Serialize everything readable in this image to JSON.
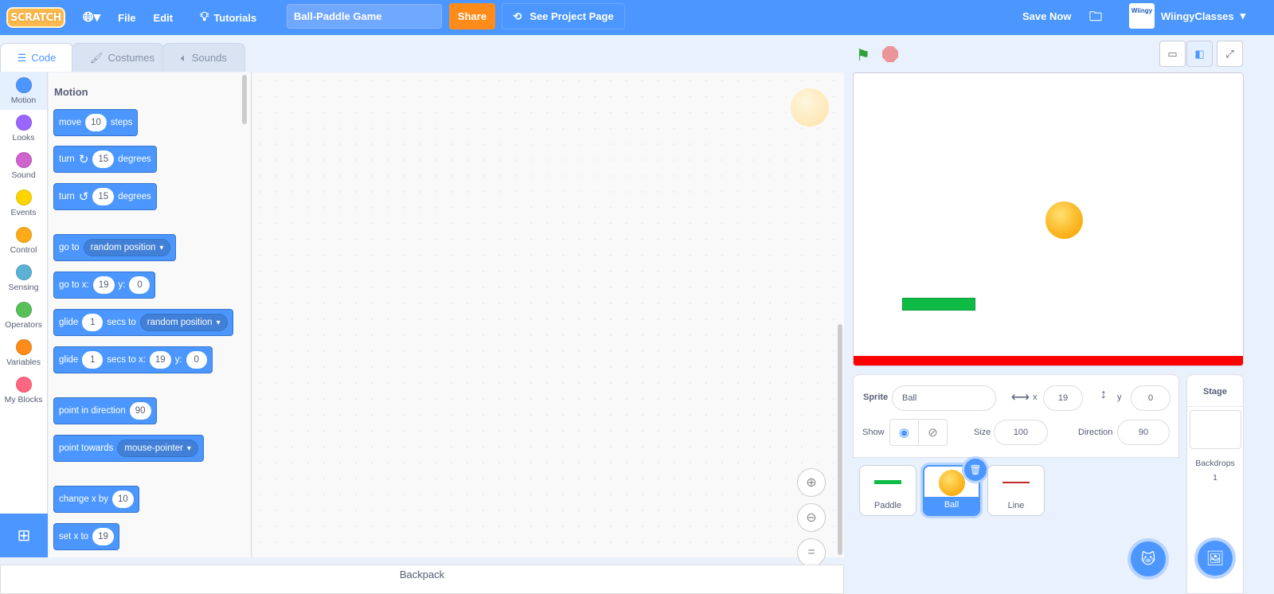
{
  "topbar": {
    "logo": "SCRATCH",
    "file": "File",
    "edit": "Edit",
    "tutorials": "Tutorials",
    "project_title": "Ball-Paddle Game",
    "share": "Share",
    "see_project_page": "See Project Page",
    "save_now": "Save Now",
    "avatar_text": "Wiingy",
    "username": "WiingyClasses",
    "color": "#4c97ff"
  },
  "tabs": [
    {
      "label": "Code",
      "icon": "code-icon"
    },
    {
      "label": "Costumes",
      "icon": "brush-icon"
    },
    {
      "label": "Sounds",
      "icon": "speaker-icon"
    }
  ],
  "categories": [
    {
      "label": "Motion",
      "color": "#4c97ff"
    },
    {
      "label": "Looks",
      "color": "#9966ff"
    },
    {
      "label": "Sound",
      "color": "#cf63cf"
    },
    {
      "label": "Events",
      "color": "#ffd500"
    },
    {
      "label": "Control",
      "color": "#ffab19"
    },
    {
      "label": "Sensing",
      "color": "#5cb1d6"
    },
    {
      "label": "Operators",
      "color": "#59c059"
    },
    {
      "label": "Variables",
      "color": "#ff8c1a"
    },
    {
      "label": "My Blocks",
      "color": "#ff6680"
    }
  ],
  "palette": {
    "heading": "Motion",
    "blocks": [
      {
        "parts": [
          {
            "t": "move"
          },
          {
            "i": "10"
          },
          {
            "t": "steps"
          }
        ]
      },
      {
        "parts": [
          {
            "t": "turn"
          },
          {
            "icon": "↻"
          },
          {
            "i": "15"
          },
          {
            "t": "degrees"
          }
        ]
      },
      {
        "parts": [
          {
            "t": "turn"
          },
          {
            "icon": "↺"
          },
          {
            "i": "15"
          },
          {
            "t": "degrees"
          }
        ]
      },
      {
        "parts": [
          {
            "t": "go to"
          },
          {
            "d": "random position"
          }
        ]
      },
      {
        "parts": [
          {
            "t": "go to x:"
          },
          {
            "i": "19"
          },
          {
            "t": "y:"
          },
          {
            "i": "0"
          }
        ]
      },
      {
        "parts": [
          {
            "t": "glide"
          },
          {
            "i": "1"
          },
          {
            "t": "secs to"
          },
          {
            "d": "random position"
          }
        ]
      },
      {
        "parts": [
          {
            "t": "glide"
          },
          {
            "i": "1"
          },
          {
            "t": "secs to x:"
          },
          {
            "i": "19"
          },
          {
            "t": "y:"
          },
          {
            "i": "0"
          }
        ]
      },
      {
        "parts": [
          {
            "t": "point in direction"
          },
          {
            "i": "90"
          }
        ]
      },
      {
        "parts": [
          {
            "t": "point towards"
          },
          {
            "d": "mouse-pointer"
          }
        ]
      },
      {
        "parts": [
          {
            "t": "change x by"
          },
          {
            "i": "10"
          }
        ]
      },
      {
        "parts": [
          {
            "t": "set x to"
          },
          {
            "i": "19"
          }
        ]
      }
    ]
  },
  "backpack": "Backpack",
  "sprite_info": {
    "sprite_label": "Sprite",
    "sprite_name": "Ball",
    "x_label": "x",
    "x": "19",
    "y_label": "y",
    "y": "0",
    "show_label": "Show",
    "size_label": "Size",
    "size": "100",
    "direction_label": "Direction",
    "direction": "90"
  },
  "sprites": [
    {
      "name": "Paddle",
      "selected": false
    },
    {
      "name": "Ball",
      "selected": true
    },
    {
      "name": "Line",
      "selected": false
    }
  ],
  "stage_panel": {
    "title": "Stage",
    "backdrops_label": "Backdrops",
    "backdrops_count": "1"
  }
}
